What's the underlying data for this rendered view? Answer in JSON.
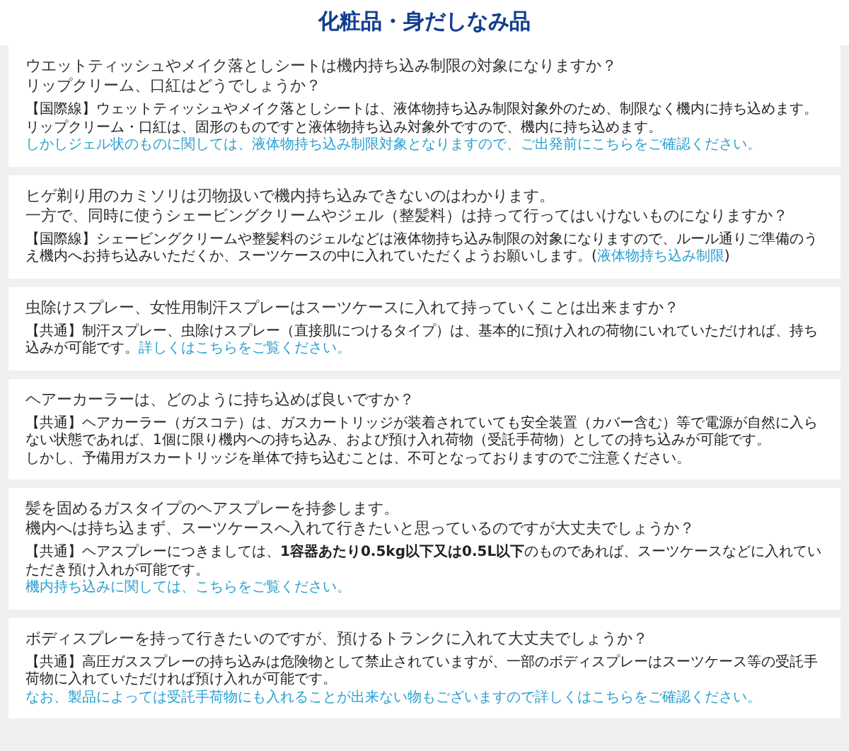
{
  "page_title": "化粧品・身だしなみ品",
  "faqs": [
    {
      "question": [
        "ウエットティッシュやメイク落としシートは機内持ち込み制限の対象になりますか？",
        "リップクリーム、口紅はどうでしょうか？"
      ],
      "answer": [
        [
          {
            "kind": "text",
            "text": "【国際線】ウェットティッシュやメイク落としシートは、液体物持ち込み制限対象外のため、制限なく機内に持ち込めます。"
          }
        ],
        [
          {
            "kind": "text",
            "text": "リップクリーム・口紅は、固形のものですと液体物持ち込み対象外ですので、機内に持ち込めます。"
          }
        ],
        [
          {
            "kind": "link",
            "text": "しかしジェル状のものに関しては、液体物持ち込み制限対象となりますので、ご出発前にこちらをご確認ください。"
          }
        ]
      ]
    },
    {
      "question": [
        "ヒゲ剃り用のカミソリは刃物扱いで機内持ち込みできないのはわかります。",
        "一方で、同時に使うシェービングクリームやジェル（整髪料）は持って行ってはいけないものになりますか？"
      ],
      "answer": [
        [
          {
            "kind": "text",
            "text": "【国際線】シェービングクリームや整髪料のジェルなどは液体物持ち込み制限の対象になりますので、ルール通りご準備のうえ機内へお持ち込みいただくか、スーツケースの中に入れていただくようお願いします。("
          },
          {
            "kind": "link",
            "text": "液体物持ち込み制限"
          },
          {
            "kind": "text",
            "text": ")"
          }
        ]
      ]
    },
    {
      "question": [
        "虫除けスプレー、女性用制汗スプレーはスーツケースに入れて持っていくことは出来ますか？"
      ],
      "answer": [
        [
          {
            "kind": "text",
            "text": "【共通】制汗スプレー、虫除けスプレー（直接肌につけるタイプ）は、基本的に預け入れの荷物にいれていただければ、持ち込みが可能です。"
          },
          {
            "kind": "link",
            "text": "詳しくはこちらをご覧ください。"
          }
        ]
      ]
    },
    {
      "question": [
        "ヘアーカーラーは、どのように持ち込めば良いですか？"
      ],
      "answer": [
        [
          {
            "kind": "text",
            "text": "【共通】ヘアカーラー（ガスコテ）は、ガスカートリッジが装着されていても安全装置（カバー含む）等で電源が自然に入らない状態であれば、1個に限り機内への持ち込み、および預け入れ荷物（受託手荷物）としての持ち込みが可能です。"
          }
        ],
        [
          {
            "kind": "text",
            "text": "しかし、予備用ガスカートリッジを単体で持ち込むことは、不可となっておりますのでご注意ください。"
          }
        ]
      ]
    },
    {
      "question": [
        "髪を固めるガスタイプのヘアスプレーを持参します。",
        "機内へは持ち込まず、スーツケースへ入れて行きたいと思っているのですが大丈夫でしょうか？"
      ],
      "answer": [
        [
          {
            "kind": "text",
            "text": "【共通】ヘアスプレーにつきましては、**1容器あたり0.5kg以下又は0.5L以下**のものであれば、スーツケースなどに入れていただき預け入れが可能です。"
          }
        ],
        [
          {
            "kind": "link",
            "text": "機内持ち込みに関しては、こちらをご覧ください。"
          }
        ]
      ]
    },
    {
      "question": [
        "ボディスプレーを持って行きたいのですが、預けるトランクに入れて大丈夫でしょうか？"
      ],
      "answer": [
        [
          {
            "kind": "text",
            "text": "【共通】高圧ガススプレーの持ち込みは危険物として禁止されていますが、一部のボディスプレーはスーツケース等の受託手荷物に入れていただければ預け入れが可能です。"
          }
        ],
        [
          {
            "kind": "link",
            "text": "なお、製品によっては受託手荷物にも入れることが出来ない物もございますので詳しくはこちらをご確認ください。"
          }
        ]
      ]
    }
  ]
}
